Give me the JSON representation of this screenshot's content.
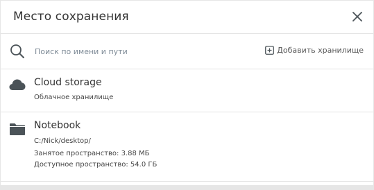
{
  "dialog": {
    "title": "Место сохранения"
  },
  "search": {
    "placeholder": "Поиск по имени и пути",
    "value": ""
  },
  "toolbar": {
    "add_storage_label": "Добавить хранилище"
  },
  "locations": [
    {
      "name": "Cloud storage",
      "description": "Облачное хранилище",
      "icon": "cloud-icon"
    },
    {
      "name": "Notebook",
      "path": "C:/Nick/desktop/",
      "used_space": "Занятое пространство: 3.88 МБ",
      "free_space": "Доступное пространство: 54.0 ГБ",
      "icon": "folder-icon"
    }
  ],
  "colors": {
    "background": "#e6e6e6",
    "surface": "#ffffff",
    "divider": "#e3e3e3",
    "icon": "#4b5358",
    "placeholder": "#7d8a96"
  }
}
